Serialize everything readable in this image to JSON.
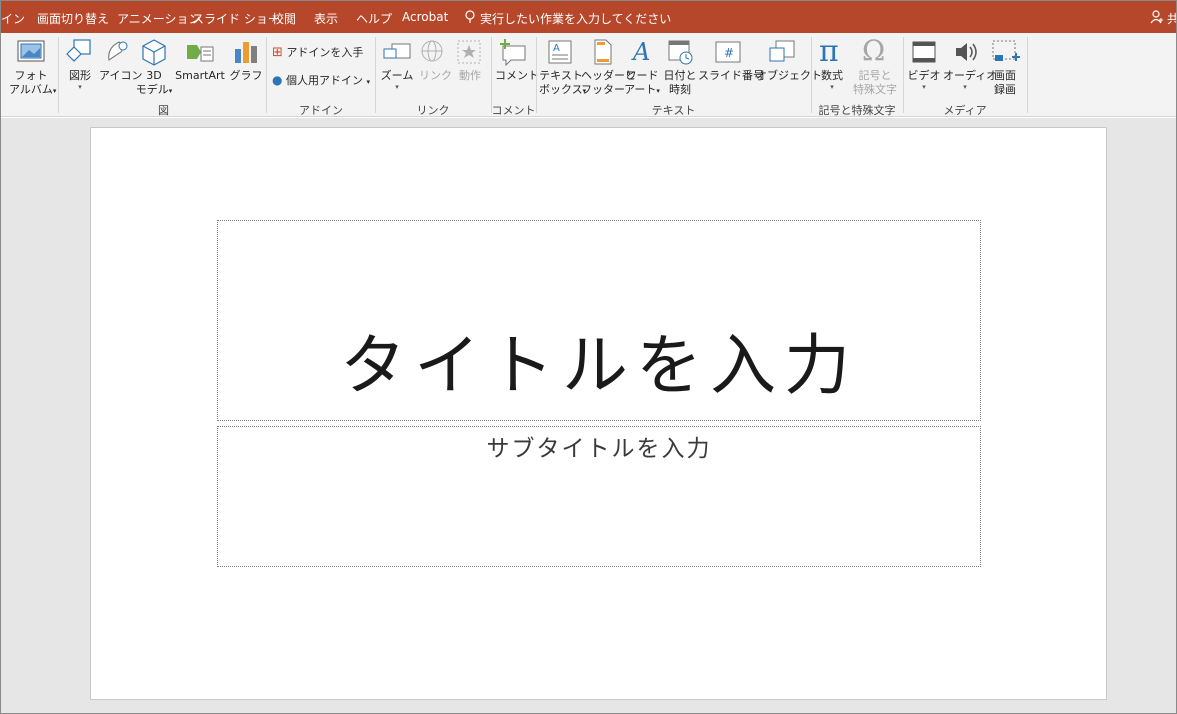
{
  "tabs": [
    "イン",
    "画面切り替え",
    "アニメーション",
    "スライド ショー",
    "校閲",
    "表示",
    "ヘルプ",
    "Acrobat"
  ],
  "tell_me": "実行したい作業を入力してください",
  "share_label": "共",
  "ribbon": {
    "photo_album": {
      "line1": "フォト",
      "line2": "アルバム"
    },
    "shapes": "図形",
    "icons": "アイコン",
    "model3d": {
      "line1": "3D",
      "line2": "モデル"
    },
    "smartart": "SmartArt",
    "chart": "グラフ",
    "get_addins": "アドインを入手",
    "my_addins": "個人用アドイン",
    "zoom": "ズーム",
    "link": "リンク",
    "action": "動作",
    "comment": "コメント",
    "textbox": {
      "line1": "テキスト",
      "line2": "ボックス"
    },
    "header_footer": {
      "line1": "ヘッダーと",
      "line2": "フッター"
    },
    "wordart": {
      "line1": "ワード",
      "line2": "アート"
    },
    "datetime": {
      "line1": "日付と",
      "line2": "時刻"
    },
    "slide_number": "スライド番号",
    "object": "オブジェクト",
    "equation": "数式",
    "symbol": {
      "line1": "記号と",
      "line2": "特殊文字"
    },
    "video": "ビデオ",
    "audio": "オーディオ",
    "screen_recording": {
      "line1": "画面",
      "line2": "録画"
    },
    "caret": "▾"
  },
  "groups": {
    "images": "図",
    "addins": "アドイン",
    "links": "リンク",
    "comments": "コメント",
    "text": "テキスト",
    "symbols": "記号と特殊文字",
    "media": "メディア"
  },
  "slide": {
    "title_placeholder": "タイトルを入力",
    "subtitle_placeholder": "サブタイトルを入力"
  },
  "colors": {
    "accent": "#b7472a",
    "ribbon_bg": "#f3f3f3",
    "workspace_bg": "#e6e6e6"
  }
}
